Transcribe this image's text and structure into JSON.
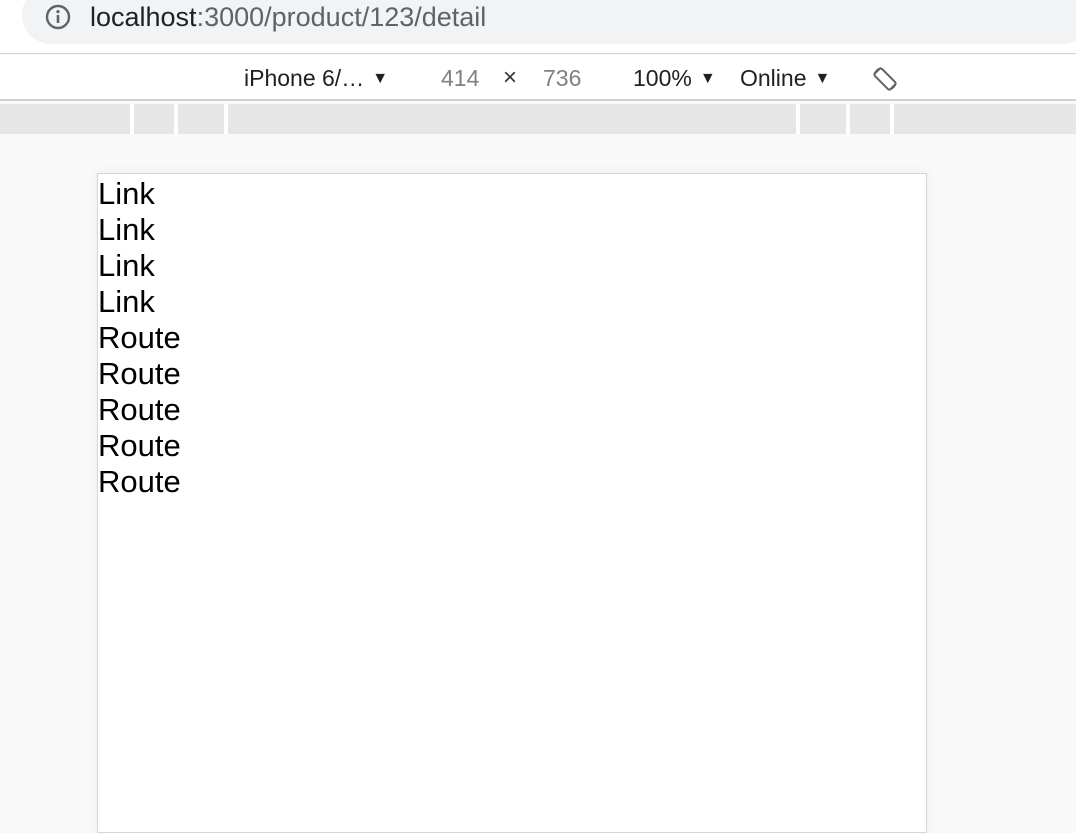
{
  "address_bar": {
    "host": "localhost",
    "path": ":3000/product/123/detail",
    "icon": "info-icon"
  },
  "device_toolbar": {
    "device": "iPhone 6/…",
    "width": "414",
    "times": "×",
    "height": "736",
    "zoom": "100%",
    "network": "Online",
    "rotate_icon": "rotate-icon"
  },
  "page": {
    "lines": [
      "Link",
      "Link",
      "Link",
      "Link",
      "Route",
      "Route",
      "Route",
      "Route",
      "Route"
    ]
  }
}
